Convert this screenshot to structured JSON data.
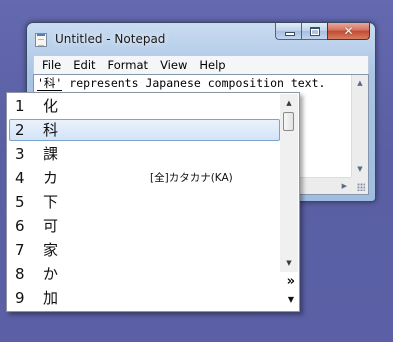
{
  "window": {
    "title": "Untitled - Notepad",
    "close_glyph": "✕"
  },
  "menu": [
    {
      "label": "File"
    },
    {
      "label": "Edit"
    },
    {
      "label": "Format"
    },
    {
      "label": "View"
    },
    {
      "label": "Help"
    }
  ],
  "editor": {
    "composition_text": "'科'",
    "rest_text": " represents Japanese composition text."
  },
  "candidates": [
    {
      "number": "1",
      "char": "化",
      "comment": ""
    },
    {
      "number": "2",
      "char": "科",
      "comment": ""
    },
    {
      "number": "3",
      "char": "課",
      "comment": ""
    },
    {
      "number": "4",
      "char": "カ",
      "comment": "[全]カタカナ(KA)"
    },
    {
      "number": "5",
      "char": "下",
      "comment": ""
    },
    {
      "number": "6",
      "char": "可",
      "comment": ""
    },
    {
      "number": "7",
      "char": "家",
      "comment": ""
    },
    {
      "number": "8",
      "char": "か",
      "comment": ""
    },
    {
      "number": "9",
      "char": "加",
      "comment": ""
    }
  ],
  "selected_candidate_index": 1,
  "candidate_scroll": {
    "up_glyph": "▲",
    "down_glyph": "▼",
    "expand_glyph": "»",
    "page_down_glyph": "▼"
  },
  "icons": {
    "app": "notepad-icon",
    "minimize": "minimize-icon",
    "maximize": "maximize-icon",
    "close": "close-icon",
    "size_grip": "size-grip-icon"
  }
}
